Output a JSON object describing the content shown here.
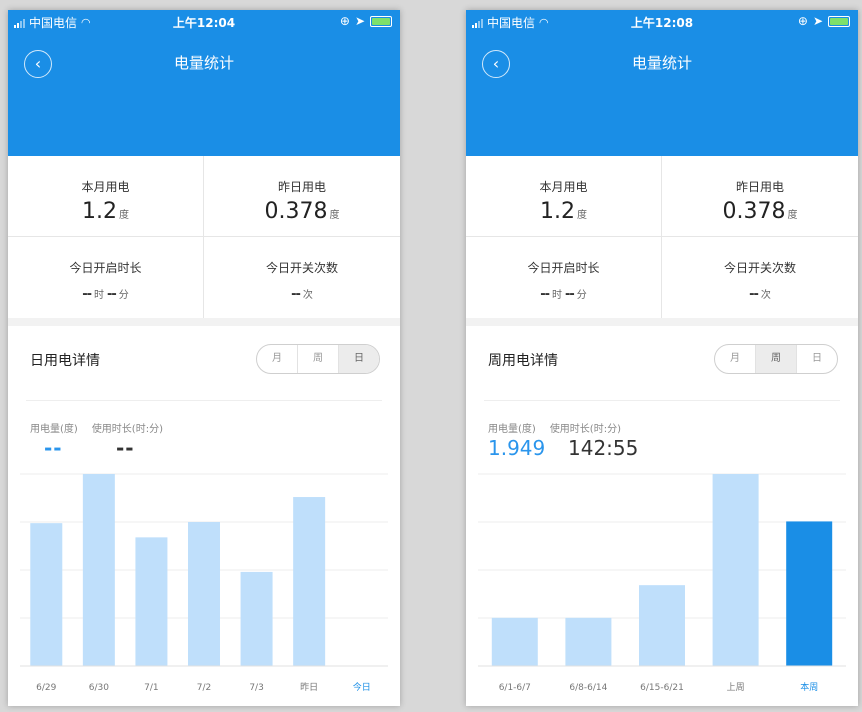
{
  "screens": [
    {
      "status": {
        "carrier": "中国电信",
        "time": "上午12:04",
        "wifi_icon": "wifi-icon",
        "location_icon": "location-icon",
        "battery_icon": "battery-icon"
      },
      "title": "电量统计",
      "stats": {
        "month_label": "本月用电",
        "month_value": "1.2",
        "month_unit": "度",
        "yesterday_label": "昨日用电",
        "yesterday_value": "0.378",
        "yesterday_unit": "度",
        "ontime_label": "今日开启时长",
        "ontime_h": "--",
        "ontime_h_unit": "时",
        "ontime_m": "--",
        "ontime_m_unit": "分",
        "switch_label": "今日开关次数",
        "switch_value": "--",
        "switch_unit": "次"
      },
      "detail": {
        "title": "日用电详情",
        "segments": [
          "月",
          "周",
          "日"
        ],
        "active_segment": "日",
        "energy_label": "用电量(度)",
        "time_label": "使用时长(时:分)",
        "energy_value": "--",
        "time_value": "--"
      },
      "chart_data": {
        "type": "bar",
        "categories": [
          "6/29",
          "6/30",
          "7/1",
          "7/2",
          "7/3",
          "昨日",
          "今日"
        ],
        "values": [
          0.372,
          0.5,
          0.335,
          0.375,
          0.245,
          0.44,
          0
        ],
        "highlight_index": 6,
        "ylim": [
          0,
          0.5
        ],
        "grid": true,
        "colors": {
          "bar": "#bfdffb",
          "highlight": "#1a8ee6",
          "label": "#777777",
          "label_highlight": "#1a8ee6"
        }
      }
    },
    {
      "status": {
        "carrier": "中国电信",
        "time": "上午12:08",
        "wifi_icon": "wifi-icon",
        "location_icon": "location-icon",
        "battery_icon": "battery-icon"
      },
      "title": "电量统计",
      "stats": {
        "month_label": "本月用电",
        "month_value": "1.2",
        "month_unit": "度",
        "yesterday_label": "昨日用电",
        "yesterday_value": "0.378",
        "yesterday_unit": "度",
        "ontime_label": "今日开启时长",
        "ontime_h": "--",
        "ontime_h_unit": "时",
        "ontime_m": "--",
        "ontime_m_unit": "分",
        "switch_label": "今日开关次数",
        "switch_value": "--",
        "switch_unit": "次"
      },
      "detail": {
        "title": "周用电详情",
        "segments": [
          "月",
          "周",
          "日"
        ],
        "active_segment": "周",
        "energy_label": "用电量(度)",
        "time_label": "使用时长(时:分)",
        "energy_value": "1.949",
        "time_value": "142:55"
      },
      "chart_data": {
        "type": "bar",
        "categories": [
          "6/1-6/7",
          "6/8-6/14",
          "6/15-6/21",
          "上周",
          "本周"
        ],
        "values": [
          0.62,
          0.62,
          1.04,
          2.47,
          1.86
        ],
        "highlight_index": 4,
        "ylim": [
          0,
          2.47
        ],
        "grid": true,
        "colors": {
          "bar": "#bfdffb",
          "highlight": "#1a8ee6",
          "label": "#777777",
          "label_highlight": "#1a8ee6"
        }
      }
    }
  ]
}
